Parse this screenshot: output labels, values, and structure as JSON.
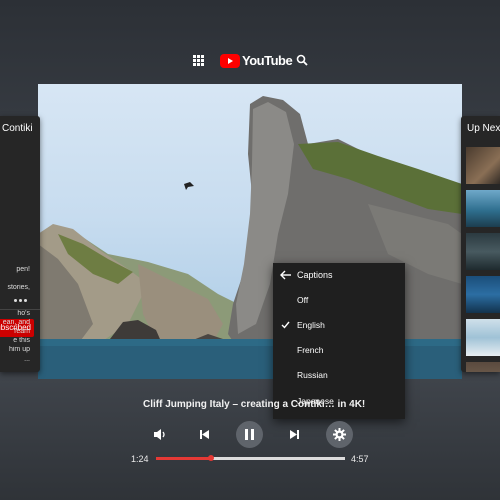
{
  "header": {
    "logo_text": "YouTube",
    "apps_icon": "apps-grid-icon",
    "search_icon": "search-icon",
    "brand_color": "#ff0000"
  },
  "channel_panel": {
    "name": "Contiki",
    "more_icon": "more-horizontal-icon",
    "subscribe_label": "Subscribed",
    "description_lines": [
      "pen!",
      "",
      "stories,",
      "",
      "ho's",
      "ean, and",
      "Team",
      "e this",
      "him up",
      "..."
    ]
  },
  "up_next": {
    "title": "Up Next"
  },
  "captions_menu": {
    "title": "Captions",
    "options": [
      {
        "label": "Off",
        "selected": false
      },
      {
        "label": "English",
        "selected": true
      },
      {
        "label": "French",
        "selected": false
      },
      {
        "label": "Russian",
        "selected": false
      },
      {
        "label": "Japanese",
        "selected": false
      }
    ]
  },
  "player": {
    "video_title": "Cliff Jumping Italy – creating a Contiki… in 4K!",
    "current_time": "1:24",
    "duration": "4:57",
    "progress": 0.29,
    "accent_color": "#e53935",
    "controls": [
      "volume-icon",
      "previous-icon",
      "pause-icon",
      "next-icon",
      "settings-icon"
    ]
  }
}
